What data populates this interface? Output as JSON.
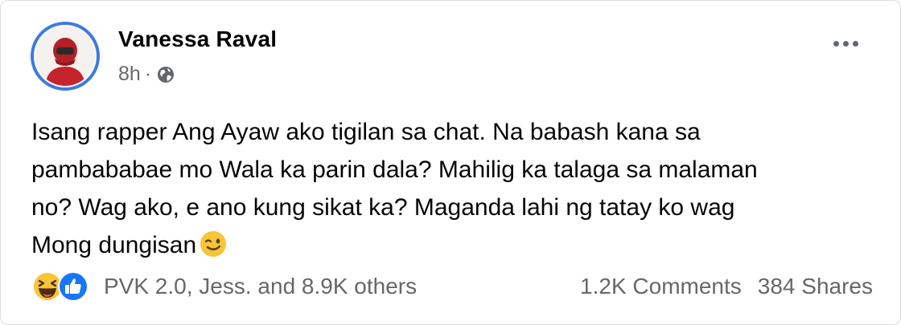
{
  "post": {
    "author": "Vanessa Raval",
    "time": "8h",
    "separator": "·",
    "text_lines": [
      "Isang rapper Ang Ayaw ako tigilan sa chat. Na babash kana sa",
      "pambababae mo Wala ka parin dala? Mahilig ka talaga sa malaman",
      "no? Wag ako, e ano kung sikat ka? Maganda lahi ng tatay ko wag",
      "Mong dungisan"
    ],
    "emoji": "winking-face-icon"
  },
  "footer": {
    "reaction_icons": [
      "haha-reaction-icon",
      "like-reaction-icon"
    ],
    "reactors": "PVK 2.0, Jess. and 8.9K others",
    "comments": "1.2K Comments",
    "shares": "384 Shares"
  },
  "colors": {
    "primary_text": "#050505",
    "secondary_text": "#65676b",
    "avatar_ring": "#3d7ae0",
    "like_blue": "#1877f2",
    "haha_yellow": "#f7c536"
  }
}
